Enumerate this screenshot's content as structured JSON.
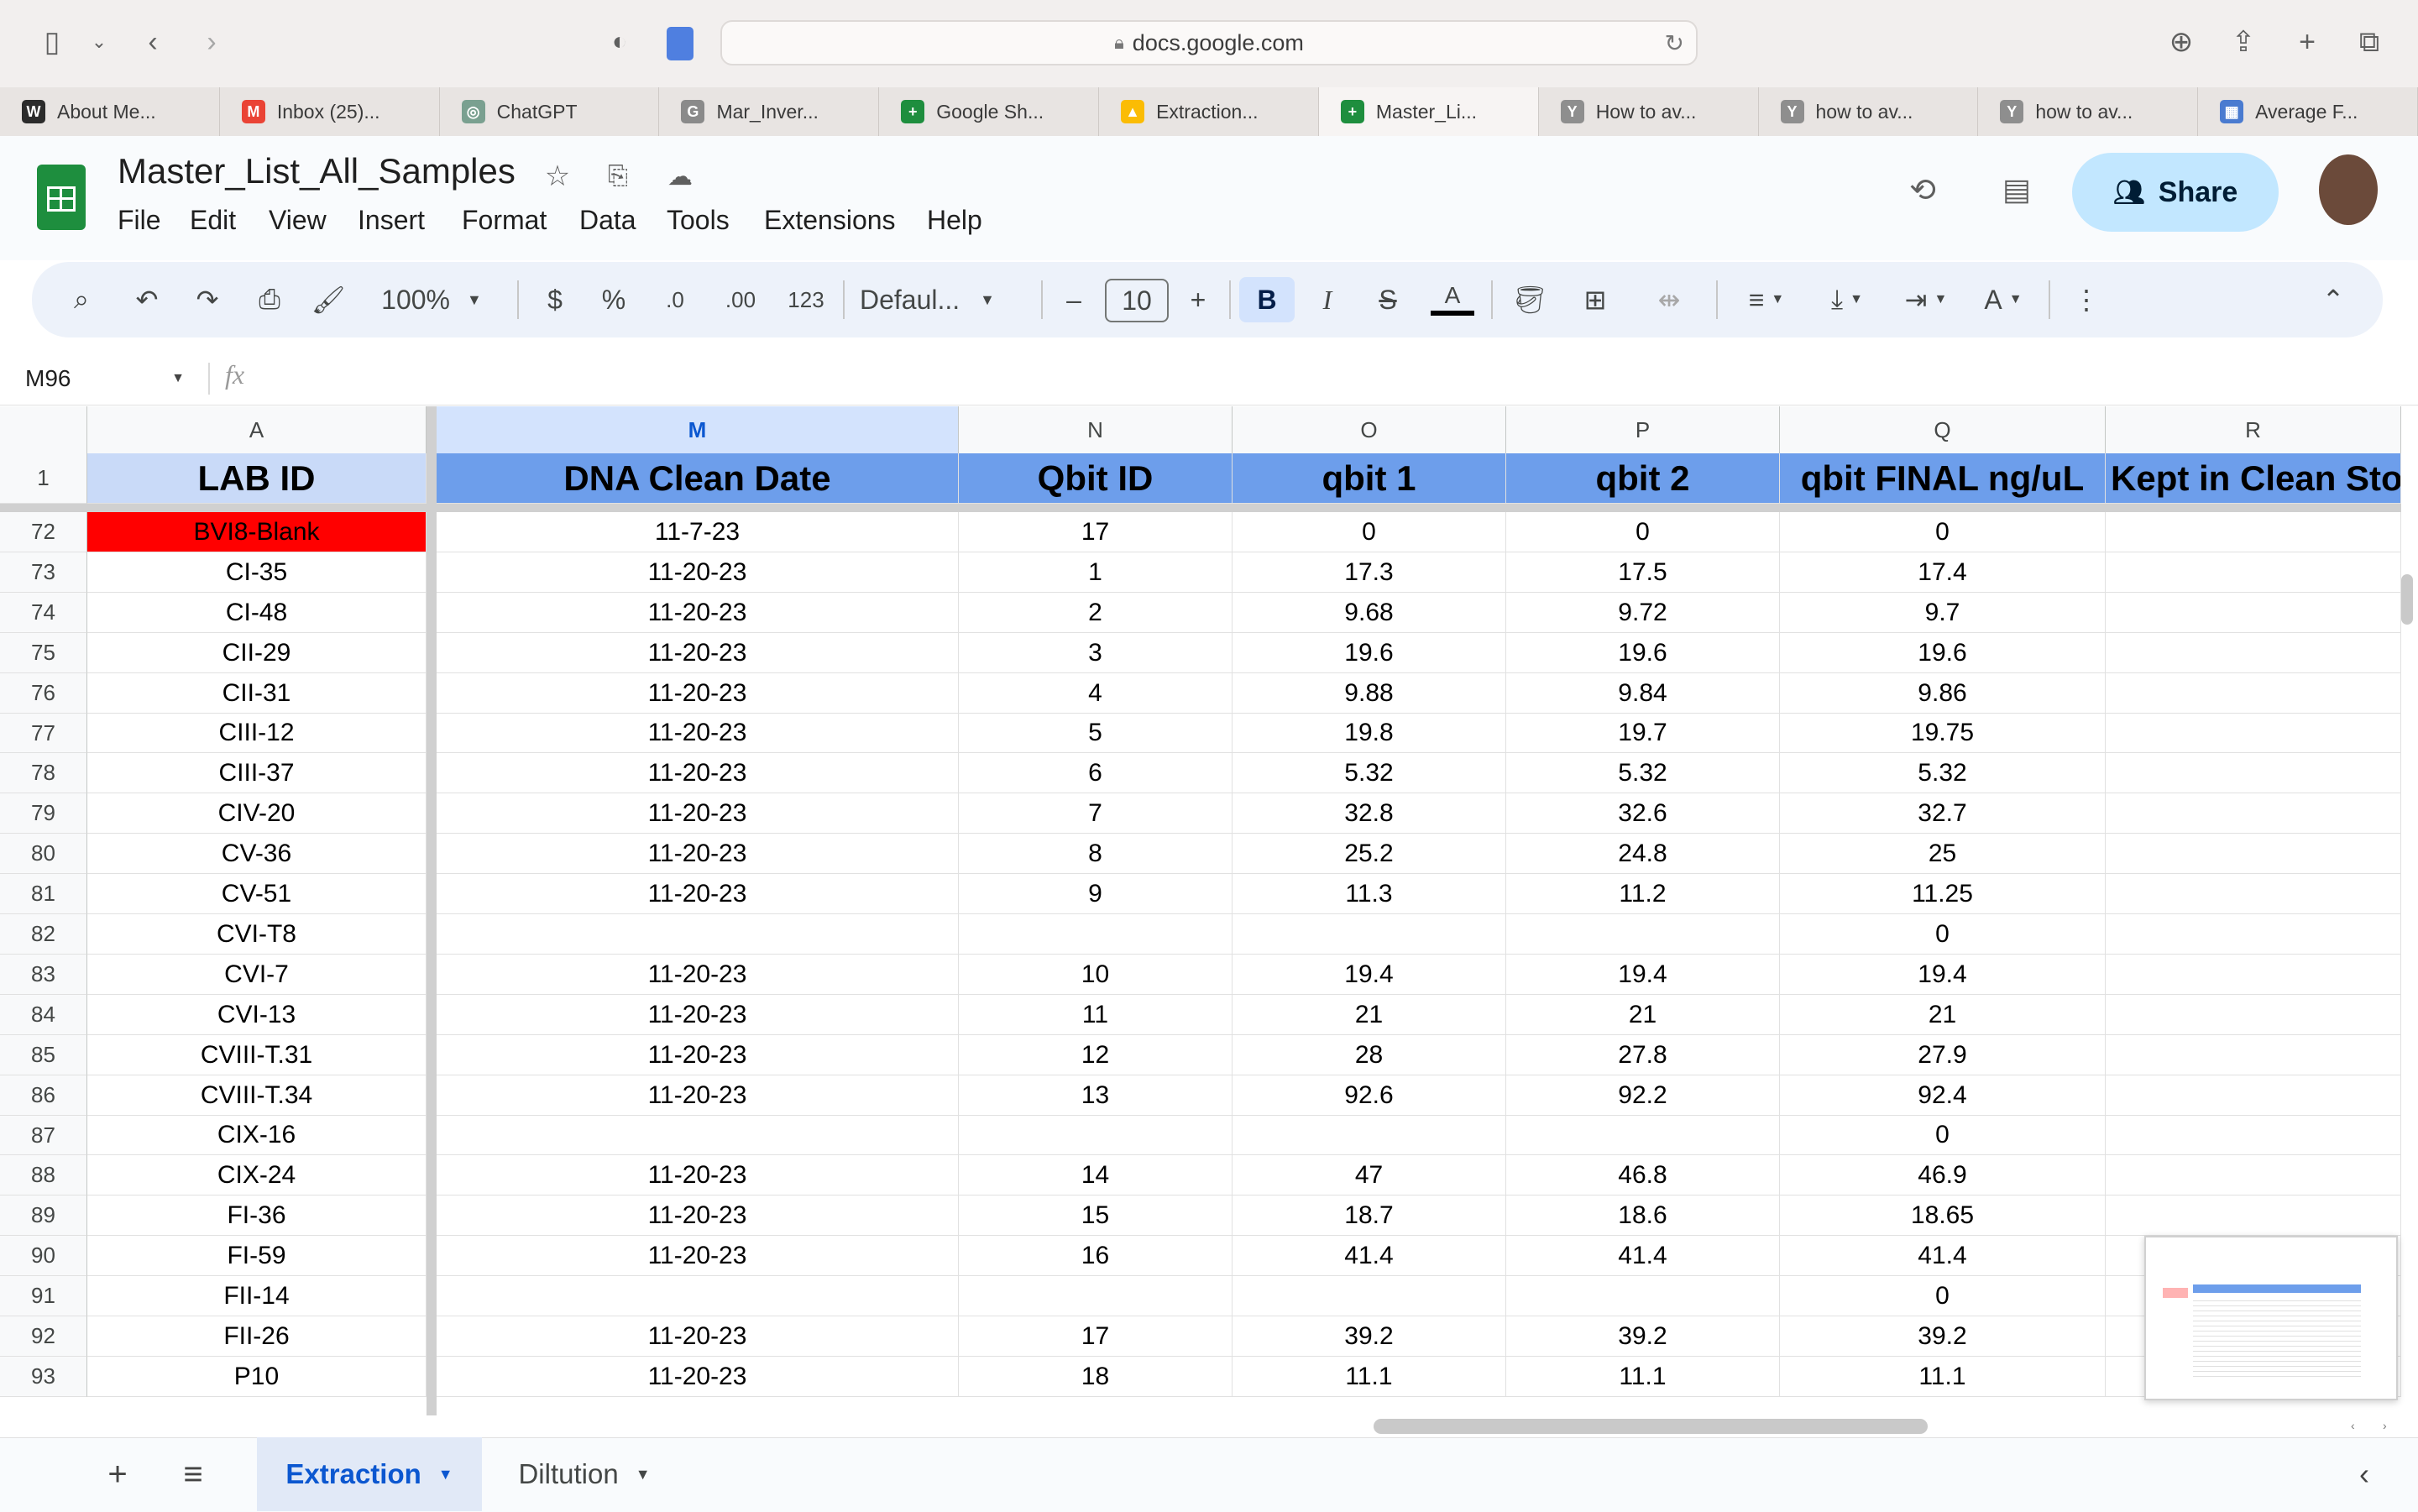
{
  "browser": {
    "url": "docs.google.com",
    "tabs": [
      {
        "label": "About Me...",
        "icon": "W",
        "color": "#2b2b2b"
      },
      {
        "label": "Inbox (25)...",
        "icon": "M",
        "color": "#ea4335"
      },
      {
        "label": "ChatGPT",
        "icon": "◎",
        "color": "#7aa090"
      },
      {
        "label": "Mar_Inver...",
        "icon": "G",
        "color": "#8a8a8a"
      },
      {
        "label": "Google Sh...",
        "icon": "+",
        "color": "#1e8e3e"
      },
      {
        "label": "Extraction...",
        "icon": "▲",
        "color": "#fbbc04"
      },
      {
        "label": "Master_Li...",
        "icon": "+",
        "color": "#1e8e3e"
      },
      {
        "label": "How to av...",
        "icon": "Y",
        "color": "#8e8e8e"
      },
      {
        "label": "how to av...",
        "icon": "Y",
        "color": "#8e8e8e"
      },
      {
        "label": "how to av...",
        "icon": "Y",
        "color": "#8e8e8e"
      },
      {
        "label": "Average F...",
        "icon": "▦",
        "color": "#4a7bd0"
      }
    ]
  },
  "header": {
    "title": "Master_List_All_Samples",
    "menu": [
      "File",
      "Edit",
      "View",
      "Insert",
      "Format",
      "Data",
      "Tools",
      "Extensions",
      "Help"
    ],
    "share_label": "Share"
  },
  "toolbar": {
    "zoom": "100%",
    "currency": "$",
    "percent": "%",
    "dec_less": ".0",
    "dec_more": ".00",
    "number_format": "123",
    "font": "Defaul...",
    "font_size": "10"
  },
  "formula_bar": {
    "name_box": "M96",
    "fx": "fx"
  },
  "grid": {
    "columns": [
      "A",
      "M",
      "N",
      "O",
      "P",
      "Q",
      "R"
    ],
    "headers": [
      "LAB ID",
      "DNA Clean Date",
      "Qbit ID",
      "qbit 1",
      "qbit 2",
      "qbit FINAL ng/uL",
      "Kept in Clean Sto"
    ],
    "rows": [
      {
        "n": "72",
        "cells": [
          "BVI8-Blank",
          "11-7-23",
          "17",
          "0",
          "0",
          "0",
          ""
        ]
      },
      {
        "n": "73",
        "cells": [
          "CI-35",
          "11-20-23",
          "1",
          "17.3",
          "17.5",
          "17.4",
          ""
        ]
      },
      {
        "n": "74",
        "cells": [
          "CI-48",
          "11-20-23",
          "2",
          "9.68",
          "9.72",
          "9.7",
          ""
        ]
      },
      {
        "n": "75",
        "cells": [
          "CII-29",
          "11-20-23",
          "3",
          "19.6",
          "19.6",
          "19.6",
          ""
        ]
      },
      {
        "n": "76",
        "cells": [
          "CII-31",
          "11-20-23",
          "4",
          "9.88",
          "9.84",
          "9.86",
          ""
        ]
      },
      {
        "n": "77",
        "cells": [
          "CIII-12",
          "11-20-23",
          "5",
          "19.8",
          "19.7",
          "19.75",
          ""
        ]
      },
      {
        "n": "78",
        "cells": [
          "CIII-37",
          "11-20-23",
          "6",
          "5.32",
          "5.32",
          "5.32",
          ""
        ]
      },
      {
        "n": "79",
        "cells": [
          "CIV-20",
          "11-20-23",
          "7",
          "32.8",
          "32.6",
          "32.7",
          ""
        ]
      },
      {
        "n": "80",
        "cells": [
          "CV-36",
          "11-20-23",
          "8",
          "25.2",
          "24.8",
          "25",
          ""
        ]
      },
      {
        "n": "81",
        "cells": [
          "CV-51",
          "11-20-23",
          "9",
          "11.3",
          "11.2",
          "11.25",
          ""
        ]
      },
      {
        "n": "82",
        "cells": [
          "CVI-T8",
          "",
          "",
          "",
          "",
          "0",
          ""
        ]
      },
      {
        "n": "83",
        "cells": [
          "CVI-7",
          "11-20-23",
          "10",
          "19.4",
          "19.4",
          "19.4",
          ""
        ]
      },
      {
        "n": "84",
        "cells": [
          "CVI-13",
          "11-20-23",
          "11",
          "21",
          "21",
          "21",
          ""
        ]
      },
      {
        "n": "85",
        "cells": [
          "CVIII-T.31",
          "11-20-23",
          "12",
          "28",
          "27.8",
          "27.9",
          ""
        ]
      },
      {
        "n": "86",
        "cells": [
          "CVIII-T.34",
          "11-20-23",
          "13",
          "92.6",
          "92.2",
          "92.4",
          ""
        ]
      },
      {
        "n": "87",
        "cells": [
          "CIX-16",
          "",
          "",
          "",
          "",
          "0",
          ""
        ]
      },
      {
        "n": "88",
        "cells": [
          "CIX-24",
          "11-20-23",
          "14",
          "47",
          "46.8",
          "46.9",
          ""
        ]
      },
      {
        "n": "89",
        "cells": [
          "FI-36",
          "11-20-23",
          "15",
          "18.7",
          "18.6",
          "18.65",
          ""
        ]
      },
      {
        "n": "90",
        "cells": [
          "FI-59",
          "11-20-23",
          "16",
          "41.4",
          "41.4",
          "41.4",
          ""
        ]
      },
      {
        "n": "91",
        "cells": [
          "FII-14",
          "",
          "",
          "",
          "",
          "0",
          ""
        ]
      },
      {
        "n": "92",
        "cells": [
          "FII-26",
          "11-20-23",
          "17",
          "39.2",
          "39.2",
          "39.2",
          ""
        ]
      },
      {
        "n": "93",
        "cells": [
          "P10",
          "11-20-23",
          "18",
          "11.1",
          "11.1",
          "11.1",
          ""
        ]
      }
    ],
    "highlight_color": "#ff0000"
  },
  "sheets": {
    "tabs": [
      "Extraction",
      "Diltution"
    ],
    "active": "Extraction"
  },
  "colors": {
    "header_blue": "#6d9eeb",
    "header_light": "#c9daf8",
    "share": "#c2e7ff"
  }
}
